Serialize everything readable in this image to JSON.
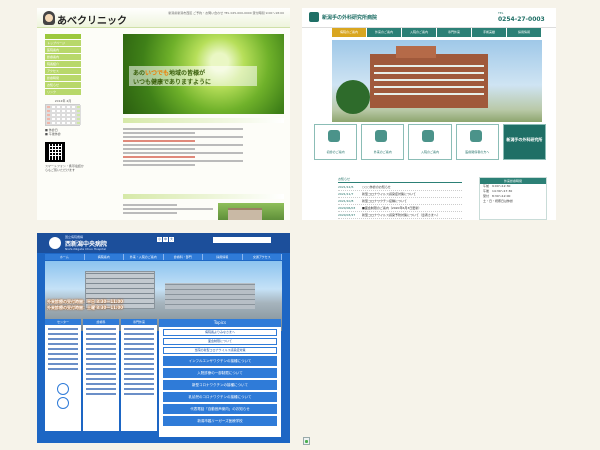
{
  "clinic": {
    "logo": "あべクリニック",
    "top_info": "新潟県新潟市西区 ご予約・お問い合わせ TEL 025-000-0000 受付時間 9:00〜18:00",
    "nav_items": [
      "トップページ",
      "医院案内",
      "診療案内",
      "院長紹介",
      "アクセス",
      "診療時間",
      "お知らせ",
      "リンク"
    ],
    "calendar_title": "2012年 4月",
    "legend_1": "■ 休診日",
    "legend_2": "■ 午後休診",
    "side_note": "スマートフォン・携帯電話からもご覧いただけます",
    "hero_line1_pre": "あの",
    "hero_line1_hl": "いつでも",
    "hero_line1_post": "地域の皆様が",
    "hero_line2": "いつも健康でありますように"
  },
  "niigata_te": {
    "logo": "新潟手の外科研究所病院",
    "tel_label": "TEL",
    "tel": "0254-27-0003",
    "nav": [
      "病院のご案内",
      "外来のご案内",
      "入院のご案内",
      "専門外来",
      "手術実績",
      "採用情報"
    ],
    "cards": [
      "初診のご案内",
      "外来のご案内",
      "入院のご案内",
      "医療関係者の方へ"
    ],
    "card_dark": "新潟手の外科研究所",
    "news_title": "お知らせ",
    "news": [
      {
        "date": "2021/12/6",
        "title": "○○○休診のお知らせ"
      },
      {
        "date": "2021/11/7",
        "title": "新型コロナウイルス感染症対策について"
      },
      {
        "date": "2021/10/8",
        "title": "新型コロナワクチン接種について"
      },
      {
        "date": "2020/06/03",
        "title": "■面会制限のご案内（2020年6月3日更新）"
      },
      {
        "date": "2020/03/27",
        "title": "新型コロナウイルス感染予防対策について（患者さまへ）"
      }
    ],
    "hours_head": "外来診療時間",
    "hours": [
      "午前　9:00〜12:30",
      "午後　14:30〜17:30",
      "受付　8:30〜12:00",
      "土・日・祝祭日は休診"
    ]
  },
  "nishi_niigata": {
    "logo_sub": "国立病院機構",
    "logo": "西新潟中央病院",
    "logo_en": "Nishi-Niigata Chuo Hospital",
    "font_sizes": [
      "小",
      "中",
      "大"
    ],
    "nav": [
      "ホーム",
      "病院案内",
      "外来・入院のご案内",
      "診療科・部門",
      "採用情報",
      "交通アクセス"
    ],
    "hours": [
      "外来診療の受付時間：平日 8:30〜11:00",
      "外来診療の受付時間：土曜 8:30〜11:00"
    ],
    "col_heads": [
      "センター",
      "診療科",
      "専門外来"
    ],
    "topics_head": "Topics",
    "topics": [
      "病院長よりみなさまへ",
      "面会制限について",
      "当院の新型コロナウイルス感染症対策",
      "インフルエンザワクチンの接種について",
      "入院診療の一部制限について",
      "新型コロナワクチンの接種について",
      "乳幼児のコロナワクチンの接種について",
      "代表電話「自動音声案内」のお知らせ",
      "新潟市臨リーガーズ医療学校"
    ]
  },
  "broken_image": {
    "icon": "broken-image-icon"
  }
}
